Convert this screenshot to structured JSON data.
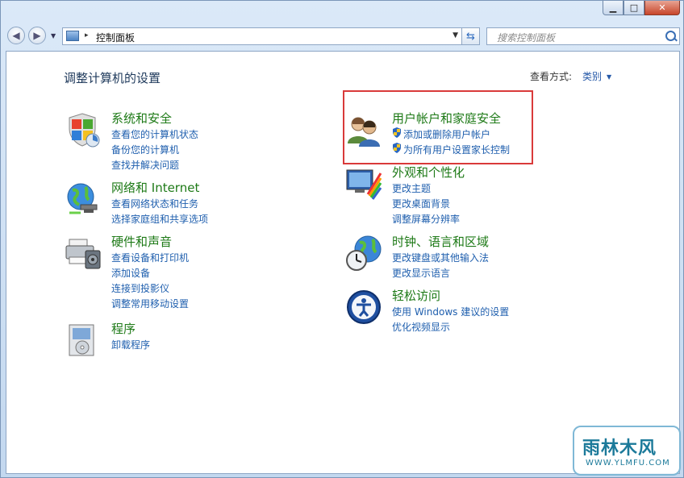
{
  "window": {
    "minimize_glyph": "▁",
    "maximize_glyph": "□",
    "close_glyph": "✕"
  },
  "toolbar": {
    "back_glyph": "◀",
    "forward_glyph": "▶",
    "breadcrumb_separator": "▸",
    "breadcrumb": "控制面板",
    "address_dropdown": "▼",
    "refresh_glyph": "⇆",
    "search_placeholder": "搜索控制面板"
  },
  "main": {
    "heading": "调整计算机的设置",
    "view_by_label": "查看方式:",
    "view_by_value": "类别"
  },
  "categories": [
    {
      "title": "系统和安全",
      "icon": "system-security-icon",
      "links": [
        "查看您的计算机状态",
        "备份您的计算机",
        "查找并解决问题"
      ]
    },
    {
      "title": "网络和 Internet",
      "icon": "network-internet-icon",
      "links": [
        "查看网络状态和任务",
        "选择家庭组和共享选项"
      ]
    },
    {
      "title": "硬件和声音",
      "icon": "hardware-sound-icon",
      "links": [
        "查看设备和打印机",
        "添加设备",
        "连接到投影仪",
        "调整常用移动设置"
      ]
    },
    {
      "title": "程序",
      "icon": "programs-icon",
      "links": [
        "卸载程序"
      ]
    },
    {
      "title": "用户帐户和家庭安全",
      "icon": "user-accounts-icon",
      "links": [
        "添加或删除用户帐户",
        "为所有用户设置家长控制"
      ]
    },
    {
      "title": "外观和个性化",
      "icon": "appearance-icon",
      "links": [
        "更改主题",
        "更改桌面背景",
        "调整屏幕分辨率"
      ]
    },
    {
      "title": "时钟、语言和区域",
      "icon": "clock-language-icon",
      "links": [
        "更改键盘或其他输入法",
        "更改显示语言"
      ]
    },
    {
      "title": "轻松访问",
      "icon": "ease-of-access-icon",
      "links": [
        "使用 Windows 建议的设置",
        "优化视频显示"
      ]
    }
  ],
  "watermark": {
    "text": "雨林木风",
    "url": "WWW.YLMFU.COM"
  },
  "colors": {
    "category_title": "#1e7a17",
    "link": "#1f5fae",
    "highlight_border": "#d93a3a"
  }
}
